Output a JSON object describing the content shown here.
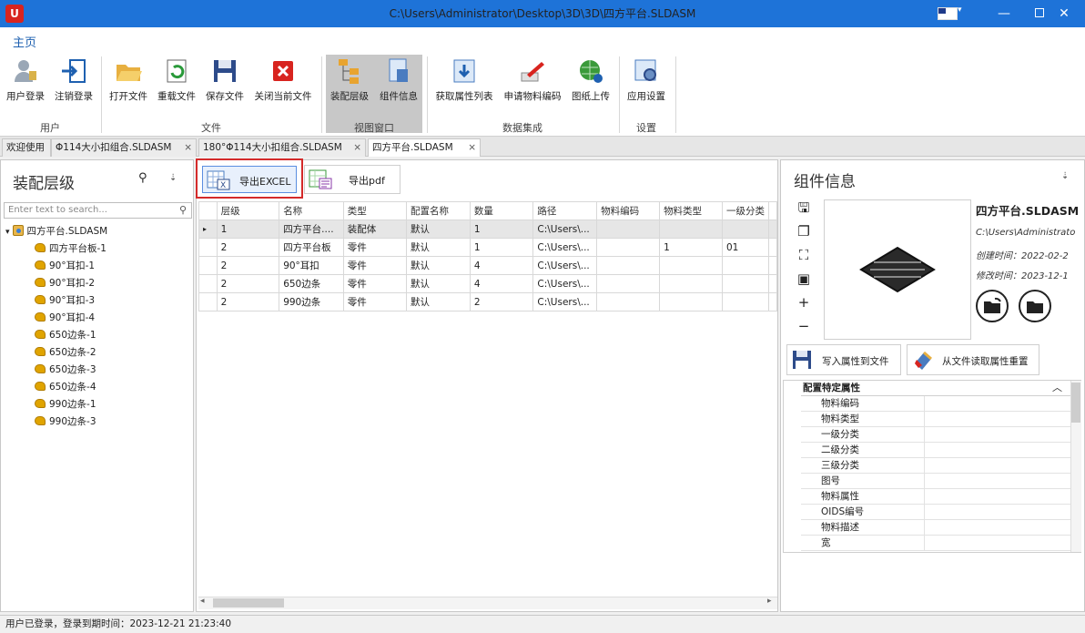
{
  "window": {
    "title": "C:\\Users\\Administrator\\Desktop\\3D\\3D\\四方平台.SLDASM",
    "app_icon_text": "U"
  },
  "ribbon": {
    "tab": "主页",
    "groups": [
      {
        "label": "用户",
        "buttons": [
          "用户登录",
          "注销登录"
        ]
      },
      {
        "label": "文件",
        "buttons": [
          "打开文件",
          "重载文件",
          "保存文件",
          "关闭当前文件"
        ]
      },
      {
        "label": "视图窗口",
        "buttons": [
          "装配层级",
          "组件信息"
        ]
      },
      {
        "label": "数据集成",
        "buttons": [
          "获取属性列表",
          "申请物料编码",
          "图纸上传"
        ]
      },
      {
        "label": "设置",
        "buttons": [
          "应用设置"
        ]
      }
    ]
  },
  "doc_tabs": [
    "欢迎使用",
    "Φ114大小扣组合.SLDASM",
    "180°Φ114大小扣组合.SLDASM",
    "四方平台.SLDASM"
  ],
  "left": {
    "title": "装配层级",
    "search_placeholder": "Enter text to search...",
    "root": "四方平台.SLDASM",
    "items": [
      "四方平台板-1",
      "90°耳扣-1",
      "90°耳扣-2",
      "90°耳扣-3",
      "90°耳扣-4",
      "650边条-1",
      "650边条-2",
      "650边条-3",
      "650边条-4",
      "990边条-1",
      "990边条-3"
    ]
  },
  "center": {
    "export_excel": "导出EXCEL",
    "export_pdf": "导出pdf",
    "columns": [
      "层级",
      "名称",
      "类型",
      "配置名称",
      "数量",
      "路径",
      "物料编码",
      "物料类型",
      "一级分类"
    ],
    "rows": [
      [
        "1",
        "四方平台....",
        "装配体",
        "默认",
        "1",
        "C:\\Users\\...",
        "",
        "",
        ""
      ],
      [
        "2",
        "四方平台板",
        "零件",
        "默认",
        "1",
        "C:\\Users\\...",
        "",
        "1",
        "01"
      ],
      [
        "2",
        "90°耳扣",
        "零件",
        "默认",
        "4",
        "C:\\Users\\...",
        "",
        "",
        ""
      ],
      [
        "2",
        "650边条",
        "零件",
        "默认",
        "4",
        "C:\\Users\\...",
        "",
        "",
        ""
      ],
      [
        "2",
        "990边条",
        "零件",
        "默认",
        "2",
        "C:\\Users\\...",
        "",
        "",
        ""
      ]
    ]
  },
  "right": {
    "title": "组件信息",
    "name": "四方平台.SLDASM",
    "path": "C:\\Users\\Administrato",
    "created": "创建时间：2022-02-2",
    "modified": "修改时间：2023-12-1",
    "write_btn": "写入属性到文件",
    "read_btn": "从文件读取属性重置",
    "prop_category": "配置特定属性",
    "props": [
      "物料编码",
      "物料类型",
      "一级分类",
      "二级分类",
      "三级分类",
      "图号",
      "物料属性",
      "OIDS编号",
      "物料描述",
      "宽"
    ]
  },
  "status": "用户已登录，登录到期时间：2023-12-21 21:23:40"
}
